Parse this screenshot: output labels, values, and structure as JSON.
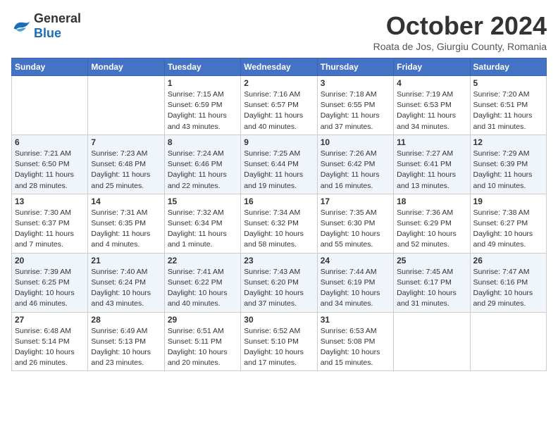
{
  "header": {
    "logo_general": "General",
    "logo_blue": "Blue",
    "month_title": "October 2024",
    "location": "Roata de Jos, Giurgiu County, Romania"
  },
  "days_of_week": [
    "Sunday",
    "Monday",
    "Tuesday",
    "Wednesday",
    "Thursday",
    "Friday",
    "Saturday"
  ],
  "weeks": [
    [
      {
        "day": "",
        "sunrise": "",
        "sunset": "",
        "daylight": ""
      },
      {
        "day": "",
        "sunrise": "",
        "sunset": "",
        "daylight": ""
      },
      {
        "day": "1",
        "sunrise": "Sunrise: 7:15 AM",
        "sunset": "Sunset: 6:59 PM",
        "daylight": "Daylight: 11 hours and 43 minutes."
      },
      {
        "day": "2",
        "sunrise": "Sunrise: 7:16 AM",
        "sunset": "Sunset: 6:57 PM",
        "daylight": "Daylight: 11 hours and 40 minutes."
      },
      {
        "day": "3",
        "sunrise": "Sunrise: 7:18 AM",
        "sunset": "Sunset: 6:55 PM",
        "daylight": "Daylight: 11 hours and 37 minutes."
      },
      {
        "day": "4",
        "sunrise": "Sunrise: 7:19 AM",
        "sunset": "Sunset: 6:53 PM",
        "daylight": "Daylight: 11 hours and 34 minutes."
      },
      {
        "day": "5",
        "sunrise": "Sunrise: 7:20 AM",
        "sunset": "Sunset: 6:51 PM",
        "daylight": "Daylight: 11 hours and 31 minutes."
      }
    ],
    [
      {
        "day": "6",
        "sunrise": "Sunrise: 7:21 AM",
        "sunset": "Sunset: 6:50 PM",
        "daylight": "Daylight: 11 hours and 28 minutes."
      },
      {
        "day": "7",
        "sunrise": "Sunrise: 7:23 AM",
        "sunset": "Sunset: 6:48 PM",
        "daylight": "Daylight: 11 hours and 25 minutes."
      },
      {
        "day": "8",
        "sunrise": "Sunrise: 7:24 AM",
        "sunset": "Sunset: 6:46 PM",
        "daylight": "Daylight: 11 hours and 22 minutes."
      },
      {
        "day": "9",
        "sunrise": "Sunrise: 7:25 AM",
        "sunset": "Sunset: 6:44 PM",
        "daylight": "Daylight: 11 hours and 19 minutes."
      },
      {
        "day": "10",
        "sunrise": "Sunrise: 7:26 AM",
        "sunset": "Sunset: 6:42 PM",
        "daylight": "Daylight: 11 hours and 16 minutes."
      },
      {
        "day": "11",
        "sunrise": "Sunrise: 7:27 AM",
        "sunset": "Sunset: 6:41 PM",
        "daylight": "Daylight: 11 hours and 13 minutes."
      },
      {
        "day": "12",
        "sunrise": "Sunrise: 7:29 AM",
        "sunset": "Sunset: 6:39 PM",
        "daylight": "Daylight: 11 hours and 10 minutes."
      }
    ],
    [
      {
        "day": "13",
        "sunrise": "Sunrise: 7:30 AM",
        "sunset": "Sunset: 6:37 PM",
        "daylight": "Daylight: 11 hours and 7 minutes."
      },
      {
        "day": "14",
        "sunrise": "Sunrise: 7:31 AM",
        "sunset": "Sunset: 6:35 PM",
        "daylight": "Daylight: 11 hours and 4 minutes."
      },
      {
        "day": "15",
        "sunrise": "Sunrise: 7:32 AM",
        "sunset": "Sunset: 6:34 PM",
        "daylight": "Daylight: 11 hours and 1 minute."
      },
      {
        "day": "16",
        "sunrise": "Sunrise: 7:34 AM",
        "sunset": "Sunset: 6:32 PM",
        "daylight": "Daylight: 10 hours and 58 minutes."
      },
      {
        "day": "17",
        "sunrise": "Sunrise: 7:35 AM",
        "sunset": "Sunset: 6:30 PM",
        "daylight": "Daylight: 10 hours and 55 minutes."
      },
      {
        "day": "18",
        "sunrise": "Sunrise: 7:36 AM",
        "sunset": "Sunset: 6:29 PM",
        "daylight": "Daylight: 10 hours and 52 minutes."
      },
      {
        "day": "19",
        "sunrise": "Sunrise: 7:38 AM",
        "sunset": "Sunset: 6:27 PM",
        "daylight": "Daylight: 10 hours and 49 minutes."
      }
    ],
    [
      {
        "day": "20",
        "sunrise": "Sunrise: 7:39 AM",
        "sunset": "Sunset: 6:25 PM",
        "daylight": "Daylight: 10 hours and 46 minutes."
      },
      {
        "day": "21",
        "sunrise": "Sunrise: 7:40 AM",
        "sunset": "Sunset: 6:24 PM",
        "daylight": "Daylight: 10 hours and 43 minutes."
      },
      {
        "day": "22",
        "sunrise": "Sunrise: 7:41 AM",
        "sunset": "Sunset: 6:22 PM",
        "daylight": "Daylight: 10 hours and 40 minutes."
      },
      {
        "day": "23",
        "sunrise": "Sunrise: 7:43 AM",
        "sunset": "Sunset: 6:20 PM",
        "daylight": "Daylight: 10 hours and 37 minutes."
      },
      {
        "day": "24",
        "sunrise": "Sunrise: 7:44 AM",
        "sunset": "Sunset: 6:19 PM",
        "daylight": "Daylight: 10 hours and 34 minutes."
      },
      {
        "day": "25",
        "sunrise": "Sunrise: 7:45 AM",
        "sunset": "Sunset: 6:17 PM",
        "daylight": "Daylight: 10 hours and 31 minutes."
      },
      {
        "day": "26",
        "sunrise": "Sunrise: 7:47 AM",
        "sunset": "Sunset: 6:16 PM",
        "daylight": "Daylight: 10 hours and 29 minutes."
      }
    ],
    [
      {
        "day": "27",
        "sunrise": "Sunrise: 6:48 AM",
        "sunset": "Sunset: 5:14 PM",
        "daylight": "Daylight: 10 hours and 26 minutes."
      },
      {
        "day": "28",
        "sunrise": "Sunrise: 6:49 AM",
        "sunset": "Sunset: 5:13 PM",
        "daylight": "Daylight: 10 hours and 23 minutes."
      },
      {
        "day": "29",
        "sunrise": "Sunrise: 6:51 AM",
        "sunset": "Sunset: 5:11 PM",
        "daylight": "Daylight: 10 hours and 20 minutes."
      },
      {
        "day": "30",
        "sunrise": "Sunrise: 6:52 AM",
        "sunset": "Sunset: 5:10 PM",
        "daylight": "Daylight: 10 hours and 17 minutes."
      },
      {
        "day": "31",
        "sunrise": "Sunrise: 6:53 AM",
        "sunset": "Sunset: 5:08 PM",
        "daylight": "Daylight: 10 hours and 15 minutes."
      },
      {
        "day": "",
        "sunrise": "",
        "sunset": "",
        "daylight": ""
      },
      {
        "day": "",
        "sunrise": "",
        "sunset": "",
        "daylight": ""
      }
    ]
  ]
}
